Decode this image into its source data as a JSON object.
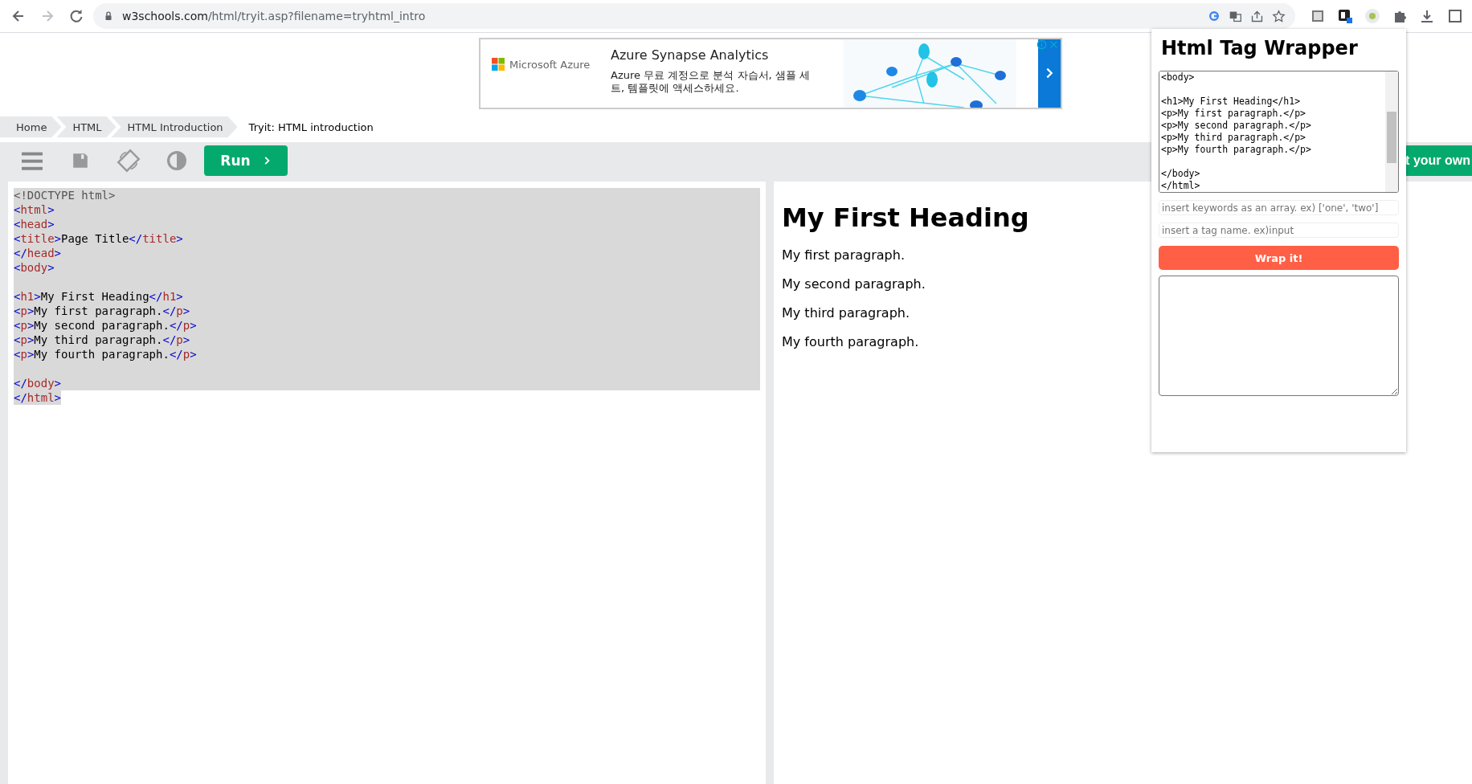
{
  "browser": {
    "url_host": "w3schools.com",
    "url_path": "/html/tryit.asp?filename=tryhtml_intro"
  },
  "ad": {
    "brand": "Microsoft Azure",
    "title": "Azure Synapse Analytics",
    "text": "Azure 무료 계정으로 분석 자습서, 샘플 세트, 템플릿에 액세스하세요."
  },
  "breadcrumb": [
    {
      "label": "Home",
      "selected": false
    },
    {
      "label": "HTML",
      "selected": false
    },
    {
      "label": "HTML Introduction",
      "selected": false
    },
    {
      "label": "Tryit: HTML introduction",
      "selected": true
    }
  ],
  "toolbar": {
    "run_label": "Run",
    "right_button": "t your own"
  },
  "editor": {
    "selected": true,
    "lines": [
      {
        "kind": "code",
        "tokens": [
          {
            "kind": "doctype",
            "text": "<!DOCTYPE html>"
          }
        ]
      },
      {
        "kind": "code",
        "tokens": [
          {
            "kind": "bracket",
            "text": "<"
          },
          {
            "kind": "tag",
            "text": "html"
          },
          {
            "kind": "bracket",
            "text": ">"
          }
        ]
      },
      {
        "kind": "code",
        "tokens": [
          {
            "kind": "bracket",
            "text": "<"
          },
          {
            "kind": "tag",
            "text": "head"
          },
          {
            "kind": "bracket",
            "text": ">"
          }
        ]
      },
      {
        "kind": "code",
        "tokens": [
          {
            "kind": "bracket",
            "text": "<"
          },
          {
            "kind": "tag",
            "text": "title"
          },
          {
            "kind": "bracket",
            "text": ">"
          },
          {
            "kind": "text",
            "text": "Page Title"
          },
          {
            "kind": "bracket",
            "text": "</"
          },
          {
            "kind": "tag",
            "text": "title"
          },
          {
            "kind": "bracket",
            "text": ">"
          }
        ]
      },
      {
        "kind": "code",
        "tokens": [
          {
            "kind": "bracket",
            "text": "</"
          },
          {
            "kind": "tag",
            "text": "head"
          },
          {
            "kind": "bracket",
            "text": ">"
          }
        ]
      },
      {
        "kind": "code",
        "tokens": [
          {
            "kind": "bracket",
            "text": "<"
          },
          {
            "kind": "tag",
            "text": "body"
          },
          {
            "kind": "bracket",
            "text": ">"
          }
        ]
      },
      {
        "kind": "blank"
      },
      {
        "kind": "code",
        "tokens": [
          {
            "kind": "bracket",
            "text": "<"
          },
          {
            "kind": "tag",
            "text": "h1"
          },
          {
            "kind": "bracket",
            "text": ">"
          },
          {
            "kind": "text",
            "text": "My First Heading"
          },
          {
            "kind": "bracket",
            "text": "</"
          },
          {
            "kind": "tag",
            "text": "h1"
          },
          {
            "kind": "bracket",
            "text": ">"
          }
        ]
      },
      {
        "kind": "code",
        "tokens": [
          {
            "kind": "bracket",
            "text": "<"
          },
          {
            "kind": "tag",
            "text": "p"
          },
          {
            "kind": "bracket",
            "text": ">"
          },
          {
            "kind": "text",
            "text": "My first paragraph."
          },
          {
            "kind": "bracket",
            "text": "</"
          },
          {
            "kind": "tag",
            "text": "p"
          },
          {
            "kind": "bracket",
            "text": ">"
          }
        ]
      },
      {
        "kind": "code",
        "tokens": [
          {
            "kind": "bracket",
            "text": "<"
          },
          {
            "kind": "tag",
            "text": "p"
          },
          {
            "kind": "bracket",
            "text": ">"
          },
          {
            "kind": "text",
            "text": "My second paragraph."
          },
          {
            "kind": "bracket",
            "text": "</"
          },
          {
            "kind": "tag",
            "text": "p"
          },
          {
            "kind": "bracket",
            "text": ">"
          }
        ]
      },
      {
        "kind": "code",
        "tokens": [
          {
            "kind": "bracket",
            "text": "<"
          },
          {
            "kind": "tag",
            "text": "p"
          },
          {
            "kind": "bracket",
            "text": ">"
          },
          {
            "kind": "text",
            "text": "My third paragraph."
          },
          {
            "kind": "bracket",
            "text": "</"
          },
          {
            "kind": "tag",
            "text": "p"
          },
          {
            "kind": "bracket",
            "text": ">"
          }
        ]
      },
      {
        "kind": "code",
        "tokens": [
          {
            "kind": "bracket",
            "text": "<"
          },
          {
            "kind": "tag",
            "text": "p"
          },
          {
            "kind": "bracket",
            "text": ">"
          },
          {
            "kind": "text",
            "text": "My fourth paragraph."
          },
          {
            "kind": "bracket",
            "text": "</"
          },
          {
            "kind": "tag",
            "text": "p"
          },
          {
            "kind": "bracket",
            "text": ">"
          }
        ]
      },
      {
        "kind": "blank"
      },
      {
        "kind": "code",
        "tokens": [
          {
            "kind": "bracket",
            "text": "</"
          },
          {
            "kind": "tag",
            "text": "body"
          },
          {
            "kind": "bracket",
            "text": ">"
          }
        ]
      },
      {
        "kind": "code",
        "tokens": [
          {
            "kind": "bracket",
            "text": "</"
          },
          {
            "kind": "tag",
            "text": "html"
          },
          {
            "kind": "bracket",
            "text": ">"
          }
        ]
      }
    ]
  },
  "output": {
    "heading": "My First Heading",
    "paragraphs": [
      "My first paragraph.",
      "My second paragraph.",
      "My third paragraph.",
      "My fourth paragraph."
    ]
  },
  "popup": {
    "title": "Html Tag Wrapper",
    "source_value": "<body>\n\n<h1>My First Heading</h1>\n<p>My first paragraph.</p>\n<p>My second paragraph.</p>\n<p>My third paragraph.</p>\n<p>My fourth paragraph.</p>\n\n</body>\n</html>",
    "keywords_placeholder": "insert keywords as an array. ex) ['one', 'two']",
    "tag_placeholder": "insert a tag name. ex)input",
    "button": "Wrap it!"
  }
}
